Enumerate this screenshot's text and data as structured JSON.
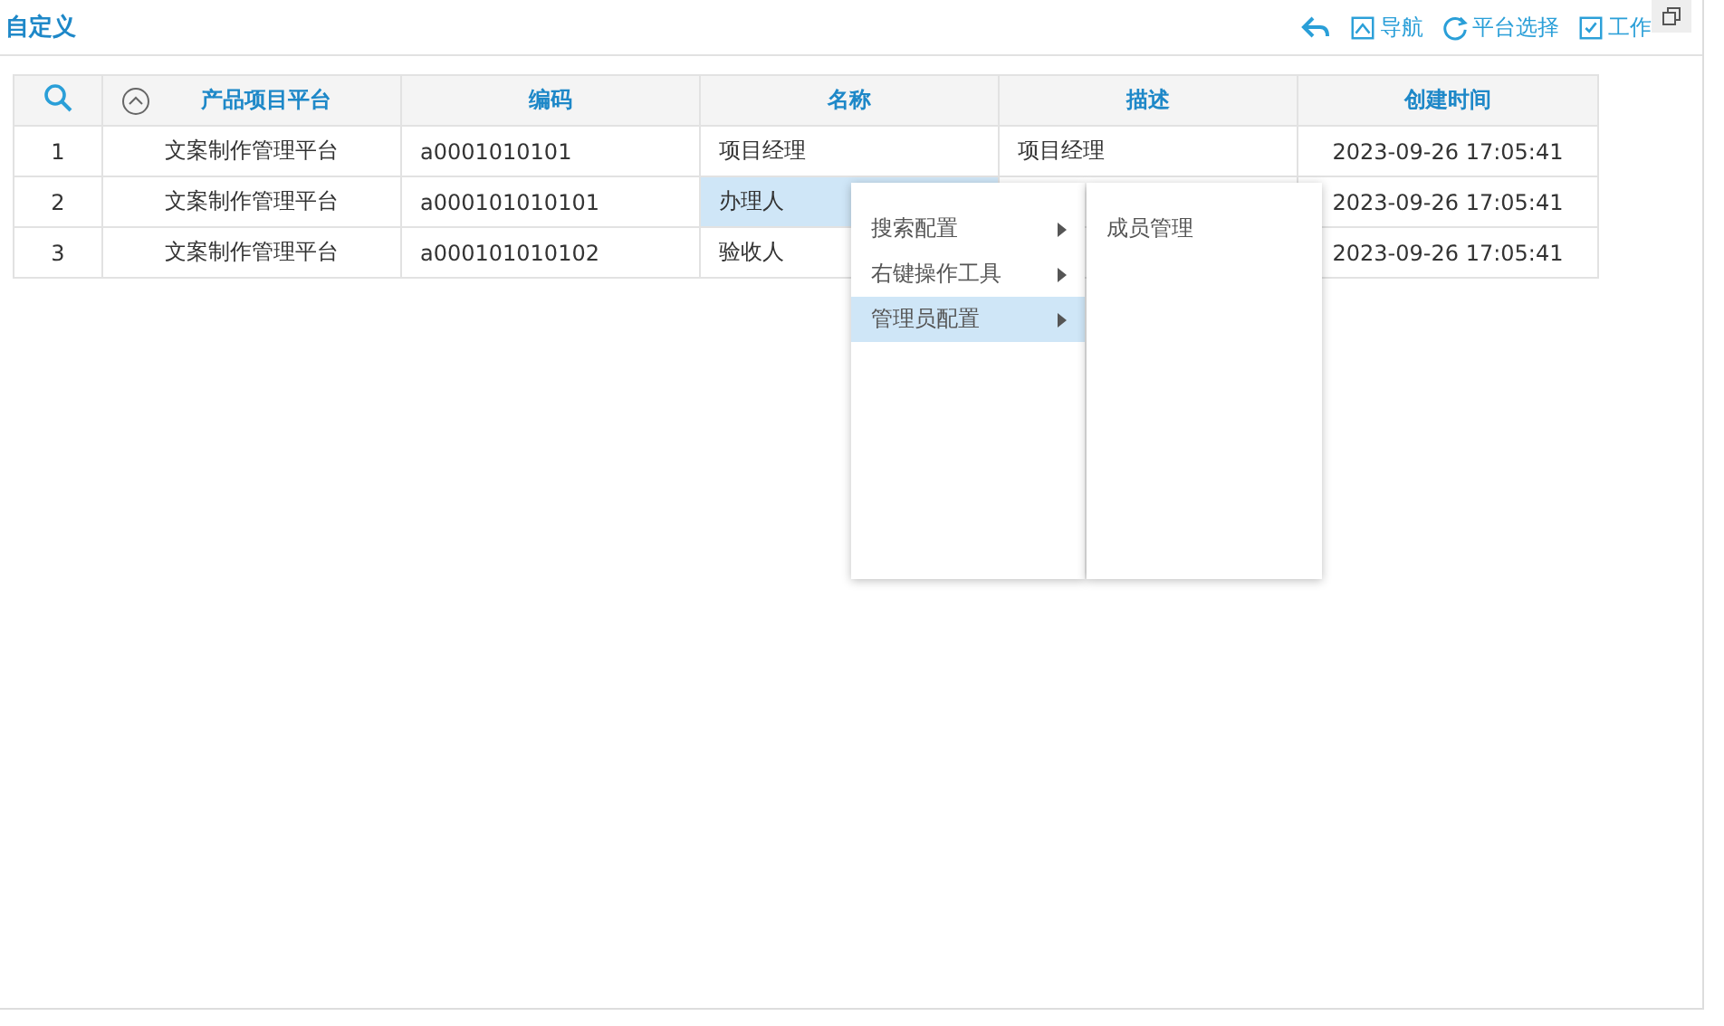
{
  "header": {
    "title": "自定义",
    "actions": [
      {
        "kind": "back"
      },
      {
        "kind": "nav",
        "label": "导航"
      },
      {
        "kind": "platform",
        "label": "平台选择"
      },
      {
        "kind": "work",
        "label": "工作"
      }
    ]
  },
  "table": {
    "columns": [
      "产品项目平台",
      "编码",
      "名称",
      "描述",
      "创建时间"
    ],
    "rows": [
      {
        "index": "1",
        "platform": "文案制作管理平台",
        "code": "a0001010101",
        "name": "项目经理",
        "description": "项目经理",
        "created": "2023-09-26 17:05:41",
        "selected": false
      },
      {
        "index": "2",
        "platform": "文案制作管理平台",
        "code": "a000101010101",
        "name": "办理人",
        "created": "2023-09-26 17:05:41",
        "selected": true
      },
      {
        "index": "3",
        "platform": "文案制作管理平台",
        "code": "a000101010102",
        "name": "验收人",
        "created": "2023-09-26 17:05:41",
        "selected": false
      }
    ]
  },
  "context_menu": {
    "items": [
      {
        "label": "搜索配置",
        "selected": false
      },
      {
        "label": "右键操作工具",
        "selected": false
      },
      {
        "label": "管理员配置",
        "selected": true
      }
    ],
    "submenu": {
      "items": [
        {
          "label": "成员管理"
        }
      ]
    }
  }
}
